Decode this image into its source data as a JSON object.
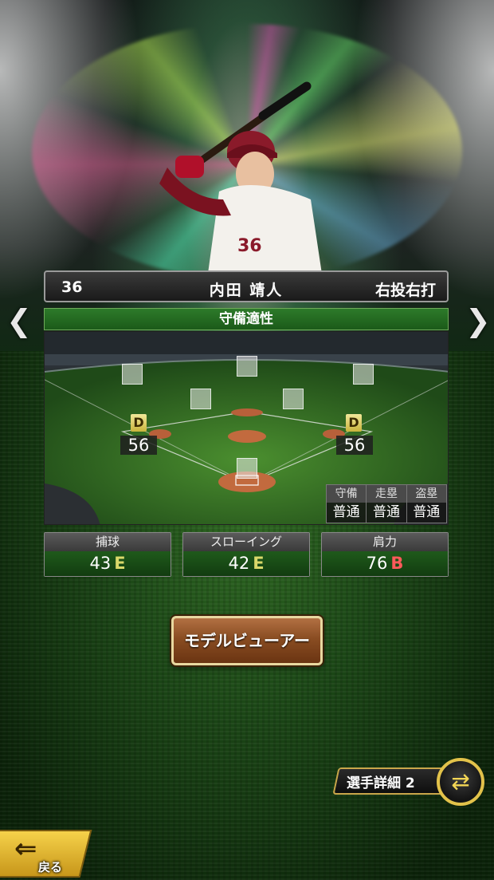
{
  "player": {
    "number": "36",
    "name": "内田 靖人",
    "handedness": "右投右打",
    "uniform_number": "36"
  },
  "defense": {
    "title": "守備適性",
    "positions": [
      {
        "grade": "D",
        "value": "56"
      },
      {
        "grade": "D",
        "value": "56"
      }
    ],
    "table": {
      "headers": [
        "守備",
        "走塁",
        "盗塁"
      ],
      "values": [
        "普通",
        "普通",
        "普通"
      ]
    }
  },
  "stats": [
    {
      "label": "捕球",
      "value": "43",
      "rank": "E",
      "rank_color": "#d9d86a"
    },
    {
      "label": "スローイング",
      "value": "42",
      "rank": "E",
      "rank_color": "#d9d86a"
    },
    {
      "label": "肩力",
      "value": "76",
      "rank": "B",
      "rank_color": "#ff5a5a"
    }
  ],
  "buttons": {
    "model_viewer": "モデルビューアー",
    "player_detail": "選手詳細 2",
    "back": "戻る"
  },
  "nav": {
    "prev": "❮",
    "next": "❯"
  },
  "colors": {
    "accent_green": "#2d7a2a",
    "gold": "#e2c24a"
  }
}
